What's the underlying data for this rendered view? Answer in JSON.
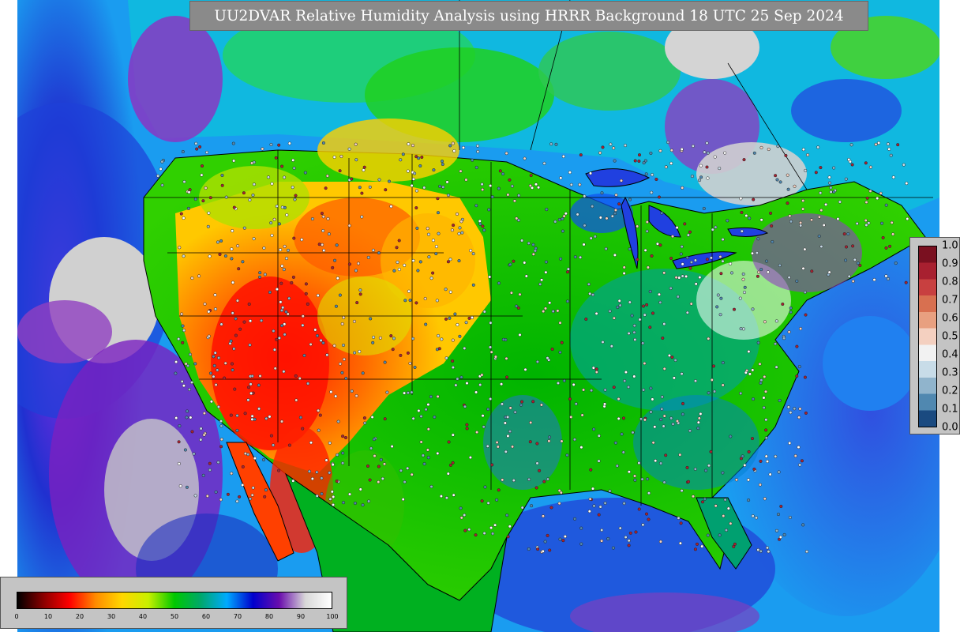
{
  "title": "UU2DVAR Relative Humidity Analysis using HRRR Background 18 UTC 25 Sep 2024",
  "colorbar_rh": {
    "ticks": [
      "0",
      "10",
      "20",
      "30",
      "40",
      "50",
      "60",
      "70",
      "80",
      "90",
      "100"
    ],
    "range": [
      0,
      100
    ],
    "stops": [
      "#000000",
      "#8b0000",
      "#ff0000",
      "#ff8c00",
      "#ffd700",
      "#c8f000",
      "#00c800",
      "#00a86b",
      "#00aaff",
      "#0000cd",
      "#6a0dad",
      "#d8d8d8",
      "#ffffff"
    ]
  },
  "colorbar_obs": {
    "ticks": [
      "1.0",
      "0.9",
      "0.8",
      "0.7",
      "0.6",
      "0.5",
      "0.4",
      "0.3",
      "0.2",
      "0.1",
      "0.0"
    ],
    "range": [
      0.0,
      1.0
    ],
    "colors": [
      "#7a1020",
      "#a82030",
      "#c84040",
      "#d87050",
      "#e8a080",
      "#f4d0c0",
      "#f2f2f2",
      "#c8dce8",
      "#90b4cc",
      "#5088b0",
      "#1a4a80"
    ]
  },
  "map_colors": {
    "ocean": "#1a9cf0",
    "border": "#000000"
  }
}
